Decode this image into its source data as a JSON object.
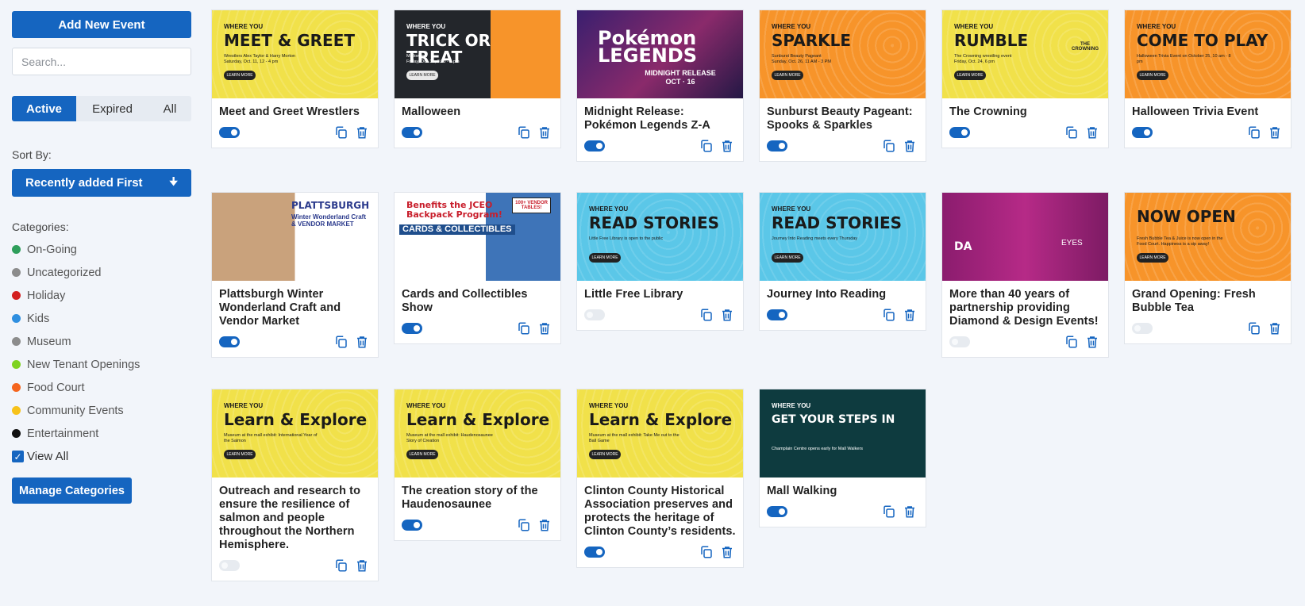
{
  "sidebar": {
    "add_button": "Add New Event",
    "search_placeholder": "Search...",
    "tabs": [
      "Active",
      "Expired",
      "All"
    ],
    "sort_label": "Sort By:",
    "sort_value": "Recently added First",
    "categories_label": "Categories:",
    "categories": [
      {
        "label": "On-Going",
        "color": "#2e9e5b"
      },
      {
        "label": "Uncategorized",
        "color": "#8c8c8c"
      },
      {
        "label": "Holiday",
        "color": "#d32020"
      },
      {
        "label": "Kids",
        "color": "#2f8fe0"
      },
      {
        "label": "Museum",
        "color": "#8c8c8c"
      },
      {
        "label": "New Tenant Openings",
        "color": "#7ed321"
      },
      {
        "label": "Food Court",
        "color": "#f5651e"
      },
      {
        "label": "Community Events",
        "color": "#f7c21a"
      },
      {
        "label": "Entertainment",
        "color": "#111111"
      }
    ],
    "view_all": "View All",
    "manage_button": "Manage Categories"
  },
  "cards": [
    {
      "title": "Meet and Greet Wrestlers",
      "active": true,
      "banner": {
        "kicker": "WHERE YOU",
        "headline": "MEET & GREET",
        "sub": "Wrestlers Alex Taylor & Harry Morton\nSaturday, Oct. 11, 12 - 4 pm",
        "button": "LEARN MORE"
      }
    },
    {
      "title": "Malloween",
      "active": true,
      "banner": {
        "kicker": "WHERE YOU",
        "headline": "TRICK OR\nTREAT",
        "sub": "Malloween\nFriday, Oct. 31, 3:30 - 6 pm",
        "button": "LEARN MORE"
      }
    },
    {
      "title": "Midnight Release: Pokémon Legends Z-A",
      "active": true,
      "banner": {
        "headline": "Pokémon\nLEGENDS",
        "sub": "MIDNIGHT RELEASE\nOCT · 16"
      }
    },
    {
      "title": "Sunburst Beauty Pageant: Spooks & Sparkles",
      "active": true,
      "banner": {
        "kicker": "WHERE YOU",
        "headline": "SPARKLE",
        "sub": "Sunburst Beauty Pageant\nSunday, Oct. 26, 11 AM - 3 PM",
        "button": "LEARN MORE"
      }
    },
    {
      "title": "The Crowning",
      "active": true,
      "banner": {
        "kicker": "WHERE YOU",
        "headline": "RUMBLE",
        "sub": "The Crowning wrestling event\nFriday, Oct. 24, 6 pm",
        "button": "LEARN MORE",
        "badge": "THE\nCROWNING"
      }
    },
    {
      "title": "Halloween Trivia Event",
      "active": true,
      "banner": {
        "kicker": "WHERE YOU",
        "headline": "COME TO PLAY",
        "sub": "Halloween Trivia Event on October 25, 10 am - 8 pm",
        "button": "LEARN MORE"
      }
    },
    {
      "title": "Plattsburgh Winter Wonderland Craft and Vendor Market",
      "active": true,
      "banner": {
        "headline": "PLATTSBURGH",
        "sub": "Winter Wonderland Craft\n& VENDOR MARKET"
      }
    },
    {
      "title": "Cards and Collectibles Show",
      "active": true,
      "banner": {
        "headline": "Benefits the JCEO\nBackpack Program!",
        "sub": "CARDS & COLLECTIBLES",
        "badge": "100+ VENDOR\nTABLES!"
      }
    },
    {
      "title": "Little Free Library",
      "active": false,
      "banner": {
        "kicker": "WHERE YOU",
        "headline": "READ STORIES",
        "sub": "Little Free Library is open to the public",
        "button": "LEARN MORE"
      }
    },
    {
      "title": "Journey Into Reading",
      "active": true,
      "banner": {
        "kicker": "WHERE YOU",
        "headline": "READ STORIES",
        "sub": "Journey Into Reading meets every Thursday",
        "button": "LEARN MORE"
      }
    },
    {
      "title": "More than 40 years of partnership providing Diamond & Design Events!",
      "active": false,
      "banner": {
        "headline": "DA",
        "sub": "EYES"
      }
    },
    {
      "title": "Grand Opening: Fresh Bubble Tea",
      "active": false,
      "banner": {
        "headline": "NOW OPEN",
        "sub": "Fresh Bubble Tea & Juice is now open in the Food Court. Happiness is a sip away!",
        "button": "LEARN MORE"
      }
    },
    {
      "title": "Outreach and research to ensure the resilience of salmon and people throughout the Northern Hemisphere.",
      "active": false,
      "banner": {
        "kicker": "WHERE YOU",
        "headline": "Learn & Explore",
        "sub": "Museum at the mall exhibit: International Year of the Salmon",
        "button": "LEARN MORE"
      }
    },
    {
      "title": "The creation story of the Haudenosaunee",
      "active": true,
      "banner": {
        "kicker": "WHERE YOU",
        "headline": "Learn & Explore",
        "sub": "Museum at the mall exhibit: Haudenosaunee Story of Creation",
        "button": "LEARN MORE"
      }
    },
    {
      "title": "Clinton County Historical Association preserves and protects the heritage of Clinton County’s residents.",
      "active": true,
      "banner": {
        "kicker": "WHERE YOU",
        "headline": "Learn & Explore",
        "sub": "Museum at the mall exhibit: Take Me out to the Ball Game",
        "button": "LEARN MORE"
      }
    },
    {
      "title": "Mall Walking",
      "active": true,
      "banner": {
        "kicker": "WHERE YOU",
        "headline": "GET YOUR STEPS IN",
        "sub": "Champlain Centre opens early for Mall Walkers"
      }
    }
  ]
}
